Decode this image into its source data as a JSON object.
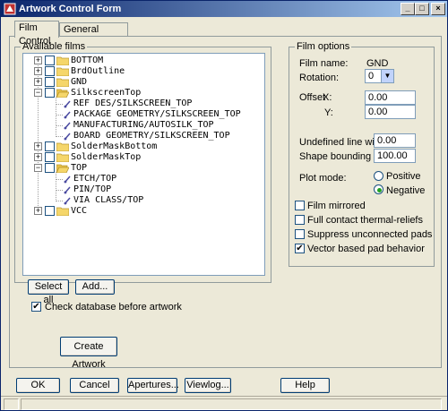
{
  "window": {
    "title": "Artwork Control Form"
  },
  "tabs": [
    {
      "label": "Film Control",
      "active": true
    },
    {
      "label": "General Parameters",
      "active": false
    }
  ],
  "available_films": {
    "legend": "Available films",
    "nodes": [
      {
        "label": "BOTTOM",
        "expanded": false,
        "depth": 0,
        "type": "folder"
      },
      {
        "label": "BrdOutline",
        "expanded": false,
        "depth": 0,
        "type": "folder"
      },
      {
        "label": "GND",
        "expanded": false,
        "depth": 0,
        "type": "folder"
      },
      {
        "label": "SilkscreenTop",
        "expanded": true,
        "depth": 0,
        "type": "folder"
      },
      {
        "label": "REF DES/SILKSCREEN_TOP",
        "depth": 1,
        "type": "leaf"
      },
      {
        "label": "PACKAGE GEOMETRY/SILKSCREEN_TOP",
        "depth": 1,
        "type": "leaf"
      },
      {
        "label": "MANUFACTURING/AUTOSILK_TOP",
        "depth": 1,
        "type": "leaf"
      },
      {
        "label": "BOARD GEOMETRY/SILKSCREEN_TOP",
        "depth": 1,
        "type": "leaf"
      },
      {
        "label": "SolderMaskBottom",
        "expanded": false,
        "depth": 0,
        "type": "folder"
      },
      {
        "label": "SolderMaskTop",
        "expanded": false,
        "depth": 0,
        "type": "folder"
      },
      {
        "label": "TOP",
        "expanded": true,
        "depth": 0,
        "type": "folder"
      },
      {
        "label": "ETCH/TOP",
        "depth": 1,
        "type": "leaf"
      },
      {
        "label": "PIN/TOP",
        "depth": 1,
        "type": "leaf"
      },
      {
        "label": "VIA CLASS/TOP",
        "depth": 1,
        "type": "leaf"
      },
      {
        "label": "VCC",
        "expanded": false,
        "depth": 0,
        "type": "folder"
      }
    ],
    "select_all_label": "Select all",
    "add_label": "Add...",
    "check_db_label": "Check database before artwork",
    "check_db_checked": true,
    "create_artwork_label": "Create Artwork"
  },
  "film_options": {
    "legend": "Film options",
    "film_name_label": "Film name:",
    "film_name_value": "GND",
    "rotation_label": "Rotation:",
    "rotation_value": "0",
    "offset_label": "Offset",
    "offset_x_label": "X:",
    "offset_x_value": "0.00",
    "offset_y_label": "Y:",
    "offset_y_value": "0.00",
    "undefined_line_width_label": "Undefined line width:",
    "undefined_line_width_value": "0.00",
    "shape_bounding_box_label": "Shape bounding box:",
    "shape_bounding_box_value": "100.00",
    "plot_mode_label": "Plot mode:",
    "plot_mode_positive_label": "Positive",
    "plot_mode_negative_label": "Negative",
    "plot_mode_selected": "Negative",
    "options": [
      {
        "label": "Film mirrored",
        "checked": false
      },
      {
        "label": "Full contact thermal-reliefs",
        "checked": false
      },
      {
        "label": "Suppress unconnected pads",
        "checked": false
      },
      {
        "label": "Vector based pad behavior",
        "checked": true
      }
    ]
  },
  "footer": {
    "ok_label": "OK",
    "cancel_label": "Cancel",
    "apertures_label": "Apertures...",
    "viewlog_label": "Viewlog...",
    "help_label": "Help"
  },
  "colors": {
    "titlebar_start": "#0a246a",
    "titlebar_end": "#a6caf0",
    "folder": "#f5d66a",
    "dialog_bg": "#ece9d8"
  },
  "icons": {
    "app": "artwork-app-icon",
    "folder": "folder-icon",
    "leaf": "film-layer-icon"
  }
}
